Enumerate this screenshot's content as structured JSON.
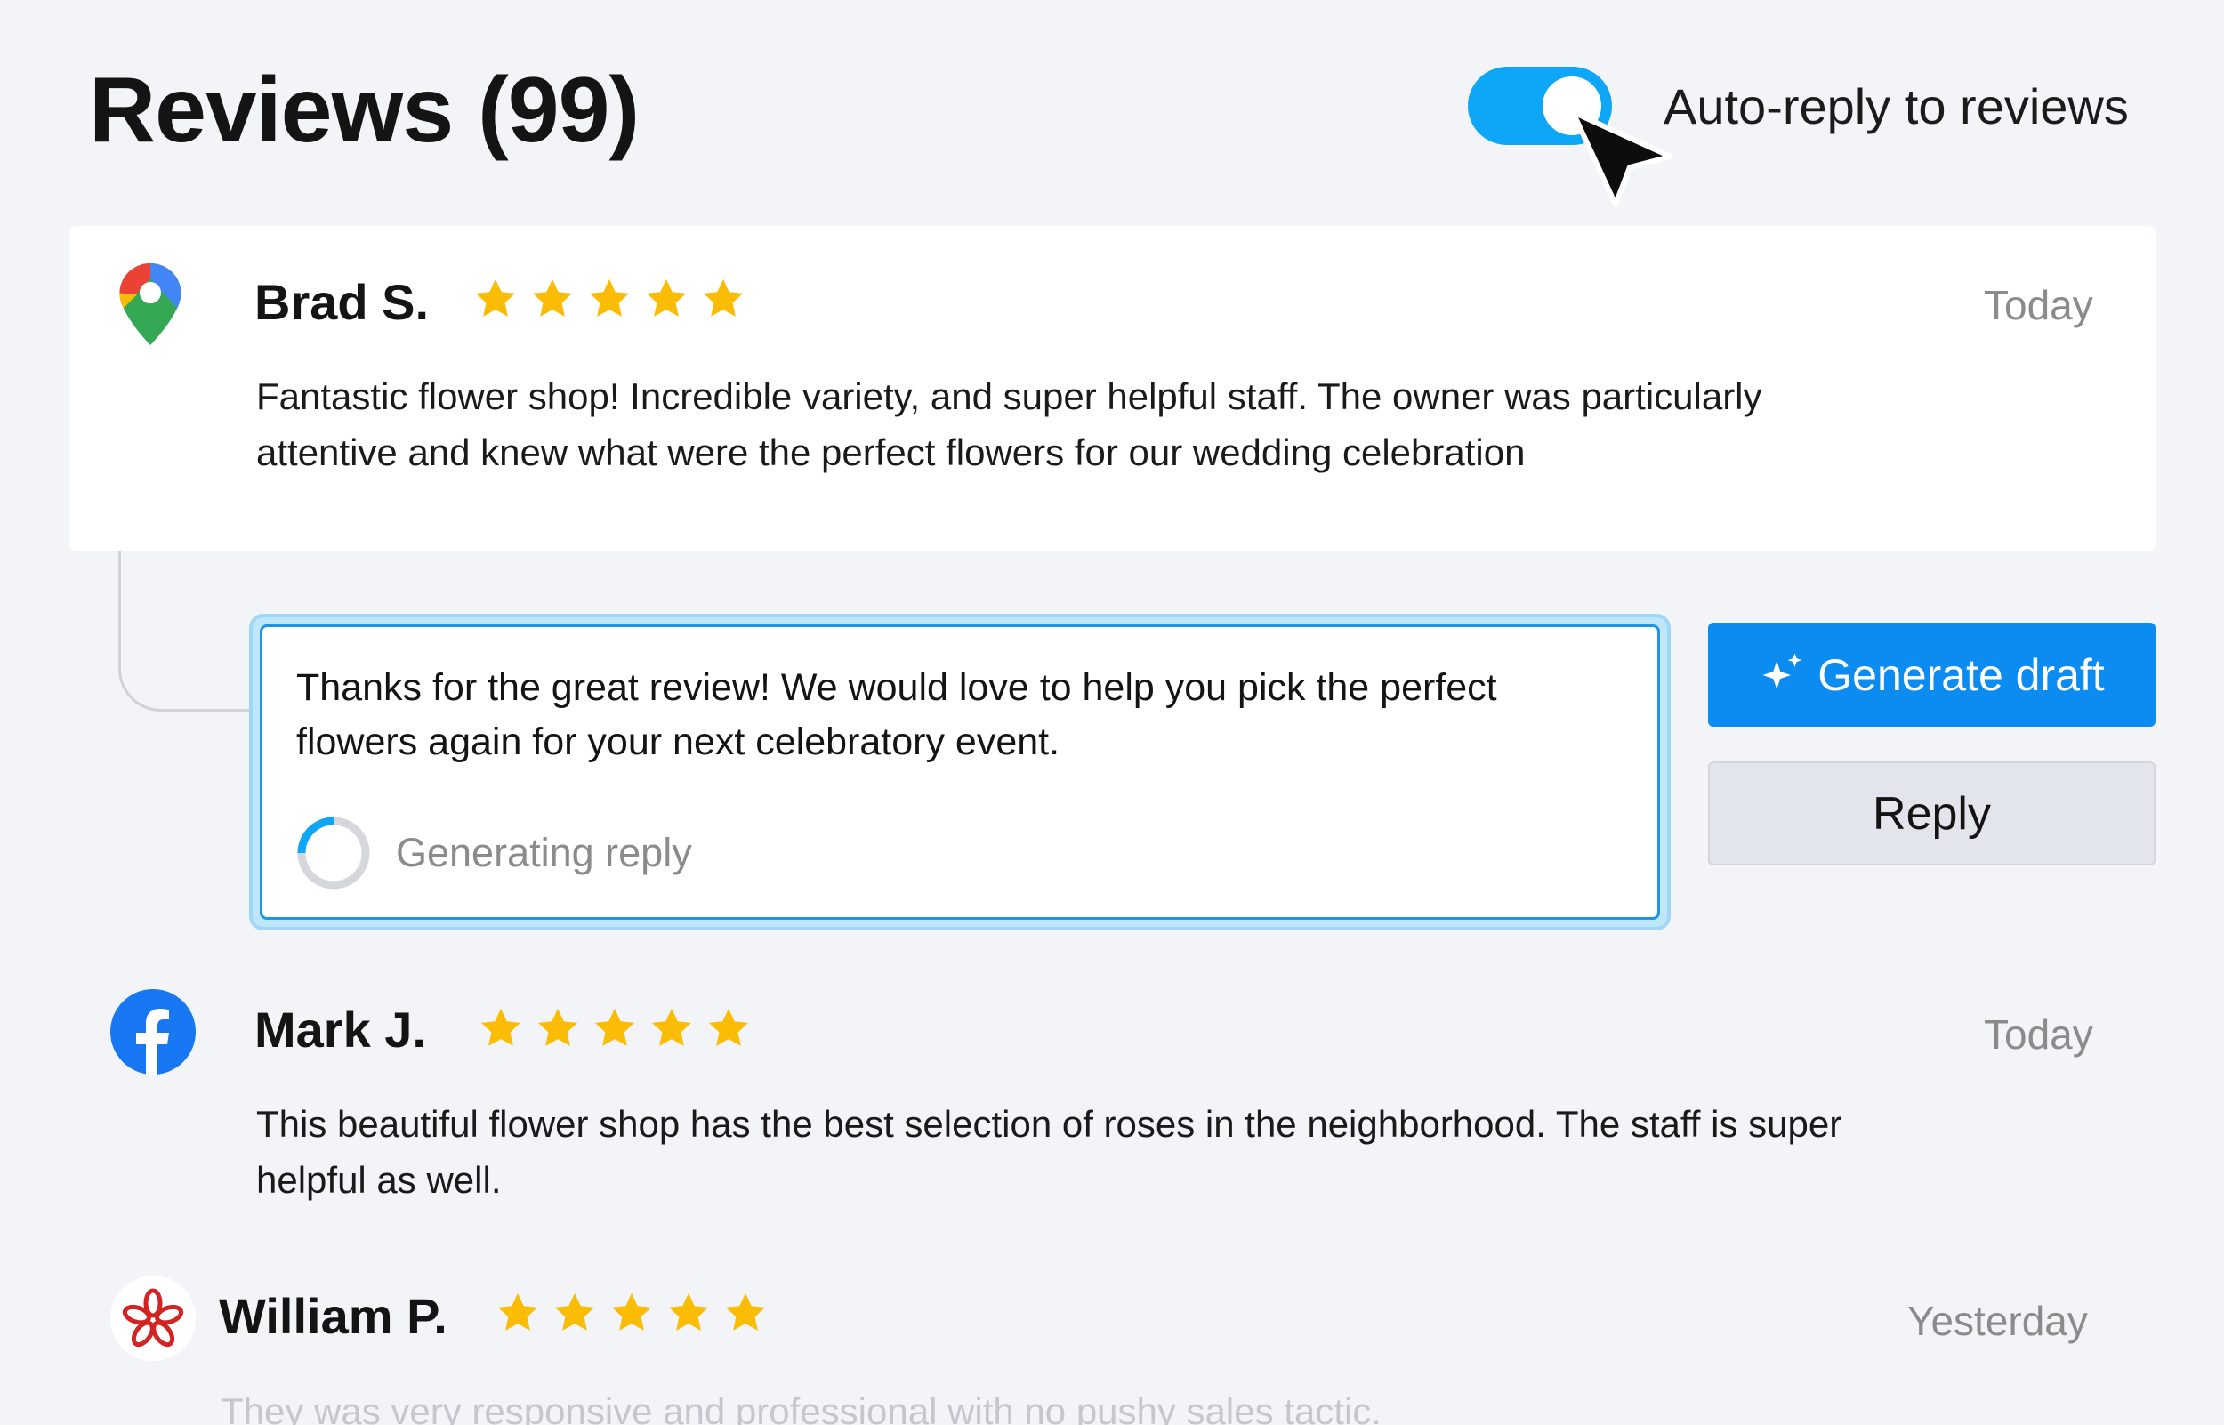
{
  "header": {
    "title": "Reviews (99)",
    "auto_reply_label": "Auto-reply to reviews",
    "auto_reply_enabled": true
  },
  "reviews": [
    {
      "source": "google-maps",
      "name": "Brad S.",
      "rating": 5,
      "date": "Today",
      "text_line1": "Fantastic flower shop! Incredible variety, and super helpful staff.  The owner was particularly",
      "text_line2": "attentive and knew what were the  perfect flowers for our wedding celebration"
    },
    {
      "source": "facebook",
      "name": "Mark J.",
      "rating": 5,
      "date": "Today",
      "text_line1": "This beautiful flower shop has the best selection of roses in the neighborhood. The staff is super",
      "text_line2": "helpful as well."
    },
    {
      "source": "yelp",
      "name": "William P.",
      "rating": 5,
      "date": "Yesterday",
      "text_line1": "They was very responsive and professional with no pushy sales tactic."
    }
  ],
  "reply": {
    "text_line1": "Thanks for the great review! We would love to help you pick the perfect",
    "text_line2": "flowers again for your next celebratory event.",
    "status": "Generating reply"
  },
  "buttons": {
    "generate_draft": "Generate draft",
    "reply": "Reply"
  },
  "colors": {
    "accent": "#0c8cf0",
    "toggle": "#0ea7f7",
    "star": "#fbbc05",
    "background": "#f3f4f8"
  }
}
